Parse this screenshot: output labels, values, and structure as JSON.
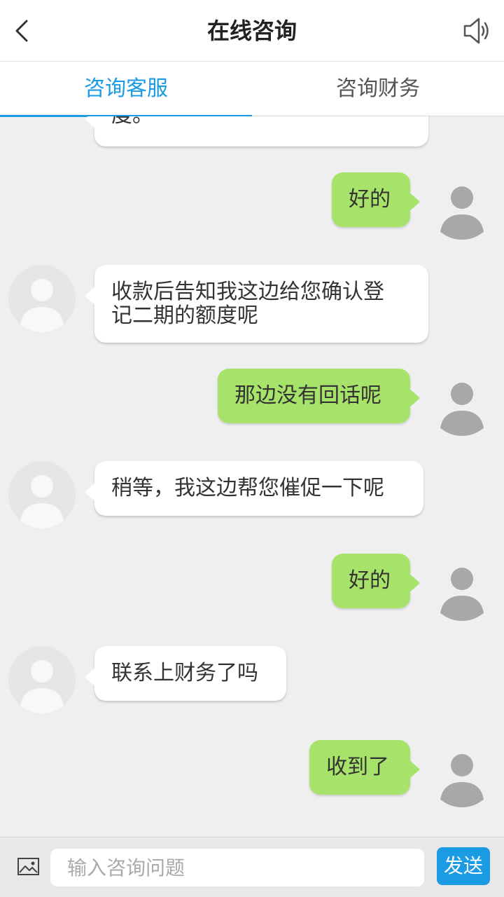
{
  "header": {
    "title": "在线咨询"
  },
  "tabs": [
    {
      "label": "咨询客服",
      "active": true
    },
    {
      "label": "咨询财务",
      "active": false
    }
  ],
  "messages": [
    {
      "side": "in",
      "lines": [
        "度。"
      ]
    },
    {
      "side": "out",
      "lines": [
        "好的"
      ]
    },
    {
      "side": "in",
      "lines": [
        "收款后告知我这边给您确认登",
        "记二期的额度呢"
      ]
    },
    {
      "side": "out",
      "lines": [
        "那边没有回话呢"
      ]
    },
    {
      "side": "in",
      "lines": [
        "稍等，我这边帮您催促一下呢"
      ]
    },
    {
      "side": "out",
      "lines": [
        "好的"
      ]
    },
    {
      "side": "in",
      "lines": [
        "联系上财务了吗"
      ]
    },
    {
      "side": "out",
      "lines": [
        "收到了"
      ]
    }
  ],
  "input": {
    "placeholder": "输入咨询问题",
    "value": ""
  },
  "send_label": "发送",
  "colors": {
    "accent": "#1a9be3",
    "outgoing_bubble": "#a7e36a",
    "incoming_bubble": "#ffffff",
    "chat_bg": "#efefef"
  },
  "icons": {
    "back": "chevron-left-icon",
    "sound": "speaker-icon",
    "image": "image-icon",
    "avatar": "user-silhouette-icon"
  }
}
